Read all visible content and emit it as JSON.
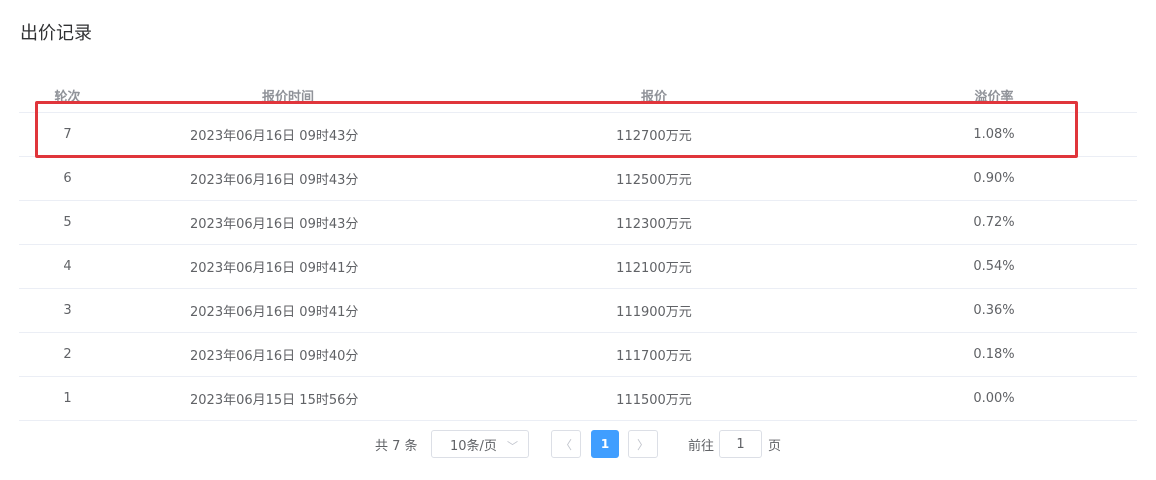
{
  "title": "出价记录",
  "table": {
    "headers": {
      "round": "轮次",
      "time": "报价时间",
      "price": "报价",
      "premium": "溢价率"
    },
    "rows": [
      {
        "round": "7",
        "time": "2023年06月16日 09时43分",
        "price": "112700万元",
        "premium": "1.08%"
      },
      {
        "round": "6",
        "time": "2023年06月16日 09时43分",
        "price": "112500万元",
        "premium": "0.90%"
      },
      {
        "round": "5",
        "time": "2023年06月16日 09时43分",
        "price": "112300万元",
        "premium": "0.72%"
      },
      {
        "round": "4",
        "time": "2023年06月16日 09时41分",
        "price": "112100万元",
        "premium": "0.54%"
      },
      {
        "round": "3",
        "time": "2023年06月16日 09时41分",
        "price": "111900万元",
        "premium": "0.36%"
      },
      {
        "round": "2",
        "time": "2023年06月16日 09时40分",
        "price": "111700万元",
        "premium": "0.18%"
      },
      {
        "round": "1",
        "time": "2023年06月15日 15时56分",
        "price": "111500万元",
        "premium": "0.00%"
      }
    ]
  },
  "pagination": {
    "total": "共 7 条",
    "page_size": "10条/页",
    "current_page": "1",
    "goto_label": "前往",
    "goto_value": "1",
    "page_unit": "页"
  },
  "colors": {
    "highlight_border": "#e0353b",
    "active_page": "#409eff"
  }
}
